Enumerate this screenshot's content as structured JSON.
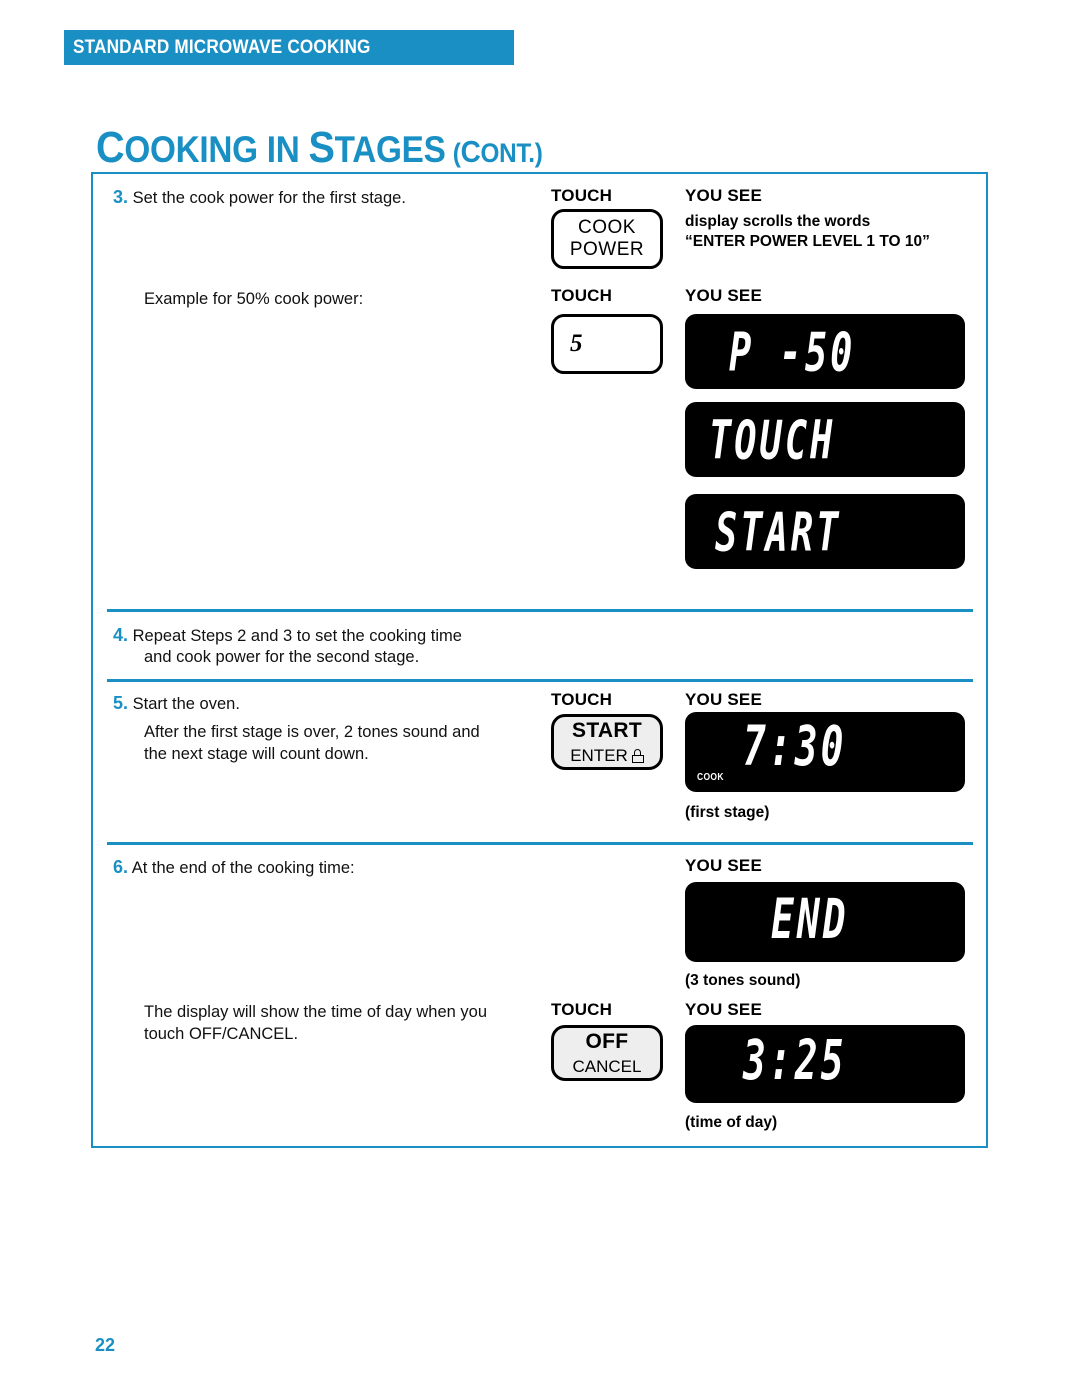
{
  "header": {
    "running_head": "STANDARD MICROWAVE COOKING"
  },
  "title": {
    "main_cap": "C",
    "main_rest": "OOKING IN ",
    "main_cap2": "S",
    "main_rest2": "TAGES",
    "cont_open": "(",
    "cont_cap": "C",
    "cont_rest": "ONT.)"
  },
  "columns": {
    "touch": "TOUCH",
    "you_see": "YOU SEE"
  },
  "steps": {
    "step3": {
      "number": "3.",
      "text": "Set the cook power for the first stage.",
      "example_text": "Example for 50% cook power:",
      "note_line1": "display scrolls the words",
      "note_line2": "“ENTER POWER LEVEL 1 TO 10”",
      "button_cook_line1": "COOK",
      "button_cook_line2": "POWER",
      "button_digit": "5",
      "display_power": "P -50",
      "display_touch": "TOUCH",
      "display_start": "START"
    },
    "step4": {
      "number": "4.",
      "line1": "Repeat Steps 2 and 3 to set the cooking time",
      "line2": "and cook power for the second stage."
    },
    "step5": {
      "number": "5.",
      "text": "Start the oven.",
      "sub_line1": "After the first stage is over, 2 tones sound and",
      "sub_line2": "the next stage will count down.",
      "button_top": "START",
      "button_bottom": "ENTER",
      "button_lock_icon": "lock-icon",
      "display_time": "7:30",
      "display_indicator": "COOK",
      "caption": "(first stage)"
    },
    "step6": {
      "number": "6.",
      "text": "At the end of the cooking time:",
      "display_end": "END",
      "caption_end": "(3 tones sound)",
      "sub_line1": "The display will show the time of day when you",
      "sub_line2": "touch OFF/CANCEL.",
      "button_top": "OFF",
      "button_bottom": "CANCEL",
      "display_clock": "3:25",
      "caption_clock": "(time of day)"
    }
  },
  "footer": {
    "page_number": "22"
  },
  "colors": {
    "accent_blue": "#1a8fc4",
    "lcd_background": "#000000",
    "lcd_text": "#ffffff",
    "button_fill": "#eeeeee"
  }
}
